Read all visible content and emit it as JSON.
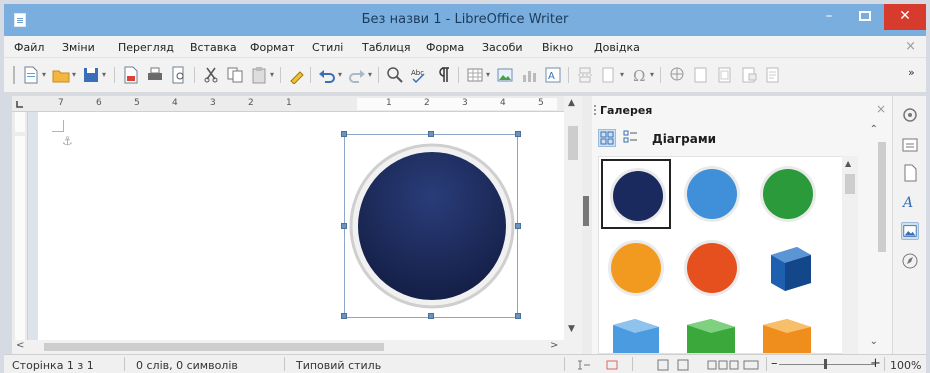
{
  "window": {
    "title": "Без назви 1 - LibreOffice Writer",
    "controls": {
      "minimize": "–",
      "close": "✕"
    }
  },
  "menu": [
    "Файл",
    "Зміни",
    "Перегляд",
    "Вставка",
    "Формат",
    "Стилі",
    "Таблиця",
    "Форма",
    "Засоби",
    "Вікно",
    "Довідка"
  ],
  "menu_close": "×",
  "ruler": {
    "left_numbers": [
      "7",
      "6",
      "5",
      "4",
      "3",
      "2",
      "1"
    ],
    "right_numbers": [
      "1",
      "2",
      "3",
      "4",
      "5"
    ]
  },
  "scroll": {
    "up": "▲",
    "down": "▼",
    "left": "<",
    "right": ">"
  },
  "gallery": {
    "title": "Галерея",
    "close": "×",
    "theme_name": "Діаграми",
    "items": [
      {
        "icon": "dark-blue-circle",
        "color": "#1b2a5e",
        "selected": true
      },
      {
        "icon": "blue-circle",
        "color": "#3f8fd9"
      },
      {
        "icon": "green-circle",
        "color": "#2b9a3a"
      },
      {
        "icon": "orange-circle",
        "color": "#f29a20"
      },
      {
        "icon": "red-orange-circle",
        "color": "#e5501e"
      },
      {
        "icon": "blue-cube",
        "color": "#1f5fb0"
      },
      {
        "icon": "light-blue-cube",
        "color": "#4a9be0"
      },
      {
        "icon": "green-cube",
        "color": "#3aa83b"
      },
      {
        "icon": "orange-cube",
        "color": "#f08e1d"
      }
    ]
  },
  "document": {
    "shape": {
      "icon": "dark-blue-circle",
      "fill": "#1b2a5e",
      "ring": "#d0d0d0"
    }
  },
  "status": {
    "page": "Сторінка 1 з 1",
    "words": "0 слів, 0 символів",
    "style": "Типовий стиль",
    "zoom": "100%",
    "zoom_minus": "–",
    "zoom_plus": "+"
  }
}
